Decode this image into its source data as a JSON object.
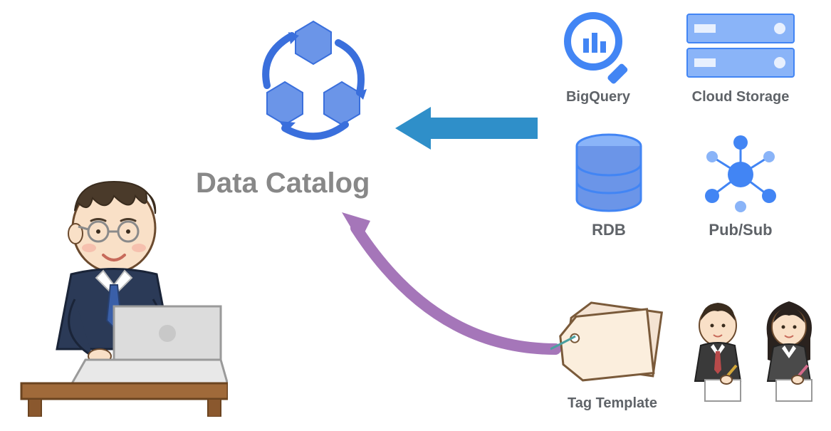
{
  "center": {
    "title": "Data Catalog"
  },
  "sources": {
    "bigquery": "BigQuery",
    "cloudstorage": "Cloud Storage",
    "rdb": "RDB",
    "pubsub": "Pub/Sub"
  },
  "bottom": {
    "tagtemplate": "Tag Template"
  }
}
